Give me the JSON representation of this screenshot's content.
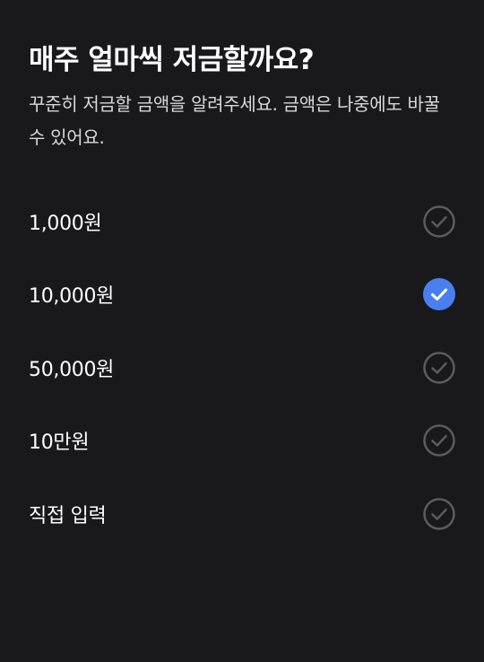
{
  "header": {
    "title": "매주 얼마씩 저금할까요?",
    "subtitle": "꾸준히 저금할 금액을 알려주세요. 금액은 나중에도 바꿀 수 있어요."
  },
  "options": [
    {
      "label": "1,000원",
      "selected": false,
      "icon": "check-circle-icon"
    },
    {
      "label": "10,000원",
      "selected": true,
      "icon": "check-circle-icon"
    },
    {
      "label": "50,000원",
      "selected": false,
      "icon": "check-circle-icon"
    },
    {
      "label": "10만원",
      "selected": false,
      "icon": "check-circle-icon"
    },
    {
      "label": "직접 입력",
      "selected": false,
      "icon": "check-circle-icon"
    }
  ],
  "colors": {
    "background": "#19191c",
    "selected": "#4a7ff0",
    "unselected": "#5b5b62"
  }
}
